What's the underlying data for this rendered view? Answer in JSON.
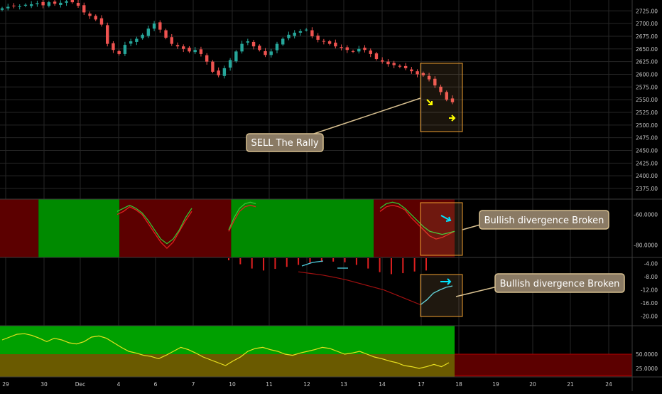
{
  "colors": {
    "background": "#000000",
    "grid": "#262626",
    "up_candle": "#26a69a",
    "down_candle": "#ef5350",
    "zone_green": "#008a00",
    "zone_red": "#5c0000",
    "highlight_box_border": "#f0a030",
    "callout_fill": "#8a7a64",
    "arrow_yellow": "#ffff00",
    "arrow_cyan": "#00e5ff",
    "osc_green": "#32c832",
    "osc_red": "#e02020",
    "macd_cyan": "#4dd0e1",
    "macd_red": "#a01010",
    "rsi_yellow": "#e8e020",
    "rsi_orange": "#e08020"
  },
  "x_axis": {
    "labels": [
      "29",
      "30",
      "Dec",
      "4",
      "6",
      "7",
      "10",
      "11",
      "12",
      "13",
      "14",
      "17",
      "18",
      "19",
      "20",
      "21",
      "24"
    ]
  },
  "annotations": {
    "sell": "SELL The Rally",
    "divergence_1": "Bullish divergence Broken",
    "divergence_2": "Bullish divergence Broken"
  },
  "chart_data": [
    {
      "type": "candlestick",
      "panel": "price",
      "y_ticks": [
        "2725.00",
        "2700.00",
        "2675.00",
        "2650.00",
        "2625.00",
        "2600.00",
        "2575.00",
        "2550.00",
        "2525.00",
        "2500.00",
        "2475.00",
        "2450.00",
        "2425.00",
        "2400.00",
        "2375.00"
      ],
      "ylim": [
        2368,
        2738
      ],
      "close_series": [
        2730,
        2733,
        2735,
        2734,
        2737,
        2738,
        2740,
        2736,
        2742,
        2739,
        2741,
        2744,
        2742,
        2735,
        2722,
        2715,
        2708,
        2698,
        2660,
        2648,
        2640,
        2658,
        2665,
        2670,
        2678,
        2690,
        2700,
        2688,
        2672,
        2660,
        2655,
        2650,
        2645,
        2648,
        2640,
        2625,
        2605,
        2598,
        2612,
        2628,
        2645,
        2660,
        2665,
        2655,
        2648,
        2638,
        2645,
        2660,
        2670,
        2678,
        2682,
        2685,
        2688,
        2675,
        2668,
        2665,
        2660,
        2655,
        2652,
        2648,
        2645,
        2650,
        2648,
        2640,
        2630,
        2625,
        2620,
        2618,
        2615,
        2612,
        2606,
        2600,
        2598,
        2590,
        2578,
        2565,
        2550,
        2545
      ]
    },
    {
      "type": "area",
      "panel": "oscillator",
      "y_ticks": [
        "-60.0000",
        "-80.0000"
      ],
      "zones": [
        {
          "from_index": 0,
          "to_index": 9,
          "state": "bearish"
        },
        {
          "from_index": 10,
          "to_index": 30,
          "state": "bullish"
        },
        {
          "from_index": 31,
          "to_index": 59,
          "state": "bearish"
        },
        {
          "from_index": 60,
          "to_index": 96,
          "state": "bullish"
        },
        {
          "from_index": 97,
          "to_index": 117,
          "state": "bearish"
        }
      ],
      "series": [
        {
          "values": [
            -60,
            -58,
            -55,
            -57,
            -60,
            -66,
            -72,
            -78,
            -82,
            -78,
            -71,
            -64,
            -58,
            -55,
            -54,
            -55,
            -57,
            -62,
            -66,
            -70,
            -74,
            -76,
            -75,
            -73,
            -71
          ]
        },
        {
          "values": [
            -58,
            -56,
            -54,
            -56,
            -59,
            -64,
            -70,
            -76,
            -79,
            -76,
            -70,
            -62,
            -56,
            -53,
            -52,
            -53,
            -56,
            -60,
            -64,
            -68,
            -71,
            -72,
            -73,
            -72,
            -71
          ]
        }
      ]
    },
    {
      "type": "histogram",
      "panel": "macd",
      "y_ticks": [
        "-4.00",
        "-8.00",
        "-12.00",
        "-16.00",
        "-20.00"
      ],
      "ylim": [
        -22,
        -3
      ],
      "histogram": [
        -3.0,
        -4.2,
        -5.5,
        -6.1,
        -5.6,
        -5.0,
        -4.4,
        -3.8,
        -3.5,
        -3.4,
        -3.6,
        -4.4,
        -5.5,
        -6.6,
        -7.2,
        -6.9,
        -6.4,
        -6.1
      ],
      "signal": [
        -6.5,
        -7.0,
        -7.5,
        -8.2,
        -9.0,
        -10.0,
        -11.0,
        -12.0,
        -13.5,
        -15.0,
        -16.5
      ],
      "macd_line": [
        -16.5,
        -15.0,
        -13.0,
        -12.0,
        -11.2,
        -10.8
      ]
    },
    {
      "type": "line",
      "panel": "rsi",
      "y_ticks": [
        "50.0000",
        "25.0000"
      ],
      "bands": [
        {
          "from": 50,
          "to": 100,
          "state": "green"
        },
        {
          "from": 15,
          "to": 50,
          "state": "orange-red"
        }
      ],
      "series": [
        {
          "values": [
            75,
            80,
            85,
            86,
            83,
            78,
            72,
            78,
            75,
            70,
            68,
            72,
            80,
            82,
            78,
            70,
            62,
            55,
            52,
            48,
            46,
            42,
            48,
            55,
            62,
            58,
            52,
            45,
            40,
            35,
            30,
            38,
            45,
            55,
            60,
            62,
            58,
            55,
            50,
            48,
            52,
            55,
            58,
            62,
            60,
            55,
            50,
            52,
            55,
            50,
            45,
            42,
            38,
            35,
            30,
            28,
            25,
            28,
            32,
            28,
            35
          ]
        }
      ]
    }
  ]
}
